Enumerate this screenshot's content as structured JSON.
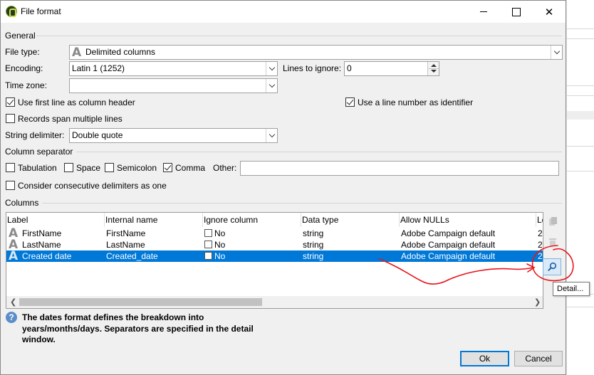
{
  "window": {
    "title": "File format",
    "buttons": [
      "minimize",
      "maximize",
      "close"
    ],
    "close_glyph": "✕"
  },
  "general": {
    "section": "General",
    "file_type_label": "File type:",
    "file_type_value": "Delimited columns",
    "encoding_label": "Encoding:",
    "encoding_value": "Latin 1 (1252)",
    "lines_to_ignore_label": "Lines to ignore:",
    "lines_to_ignore_value": "0",
    "time_zone_label": "Time zone:",
    "time_zone_value": "",
    "use_first_line_label": "Use first line as column header",
    "use_first_line_checked": true,
    "use_line_number_label": "Use a line number as identifier",
    "use_line_number_checked": true,
    "records_span_label": "Records span multiple lines",
    "records_span_checked": false,
    "string_delimiter_label": "String delimiter:",
    "string_delimiter_value": "Double quote"
  },
  "column_separator": {
    "section": "Column separator",
    "tabulation": "Tabulation",
    "space": "Space",
    "semicolon": "Semicolon",
    "comma": "Comma",
    "comma_checked": true,
    "other_label": "Other:",
    "other_value": "",
    "consider_consecutive": "Consider consecutive delimiters as one"
  },
  "columns": {
    "section": "Columns",
    "headers": [
      "Label",
      "Internal name",
      "Ignore column",
      "Data type",
      "Allow NULLs",
      "Le"
    ],
    "rows": [
      {
        "label": "FirstName",
        "internal": "FirstName",
        "ignore": "No",
        "type": "string",
        "nulls": "Adobe Campaign default",
        "len": "2"
      },
      {
        "label": "LastName",
        "internal": "LastName",
        "ignore": "No",
        "type": "string",
        "nulls": "Adobe Campaign default",
        "len": "2"
      },
      {
        "label": "Created date",
        "internal": "Created_date",
        "ignore": "No",
        "type": "string",
        "nulls": "Adobe Campaign default",
        "len": "2"
      }
    ],
    "selected_row": 2,
    "tooltip": "Detail..."
  },
  "help": {
    "text": "The dates format defines the breakdown into years/months/days. Separators are specified in the detail window."
  },
  "footer": {
    "ok": "Ok",
    "cancel": "Cancel"
  },
  "icons": {
    "app": "campaign-app-icon",
    "attribute": "letter-a-icon",
    "detail": "magnifier-icon",
    "help": "question-icon"
  },
  "colors": {
    "selection": "#0078d7",
    "annotation": "#e8141b",
    "dialog_bg": "#f0f0f0"
  }
}
